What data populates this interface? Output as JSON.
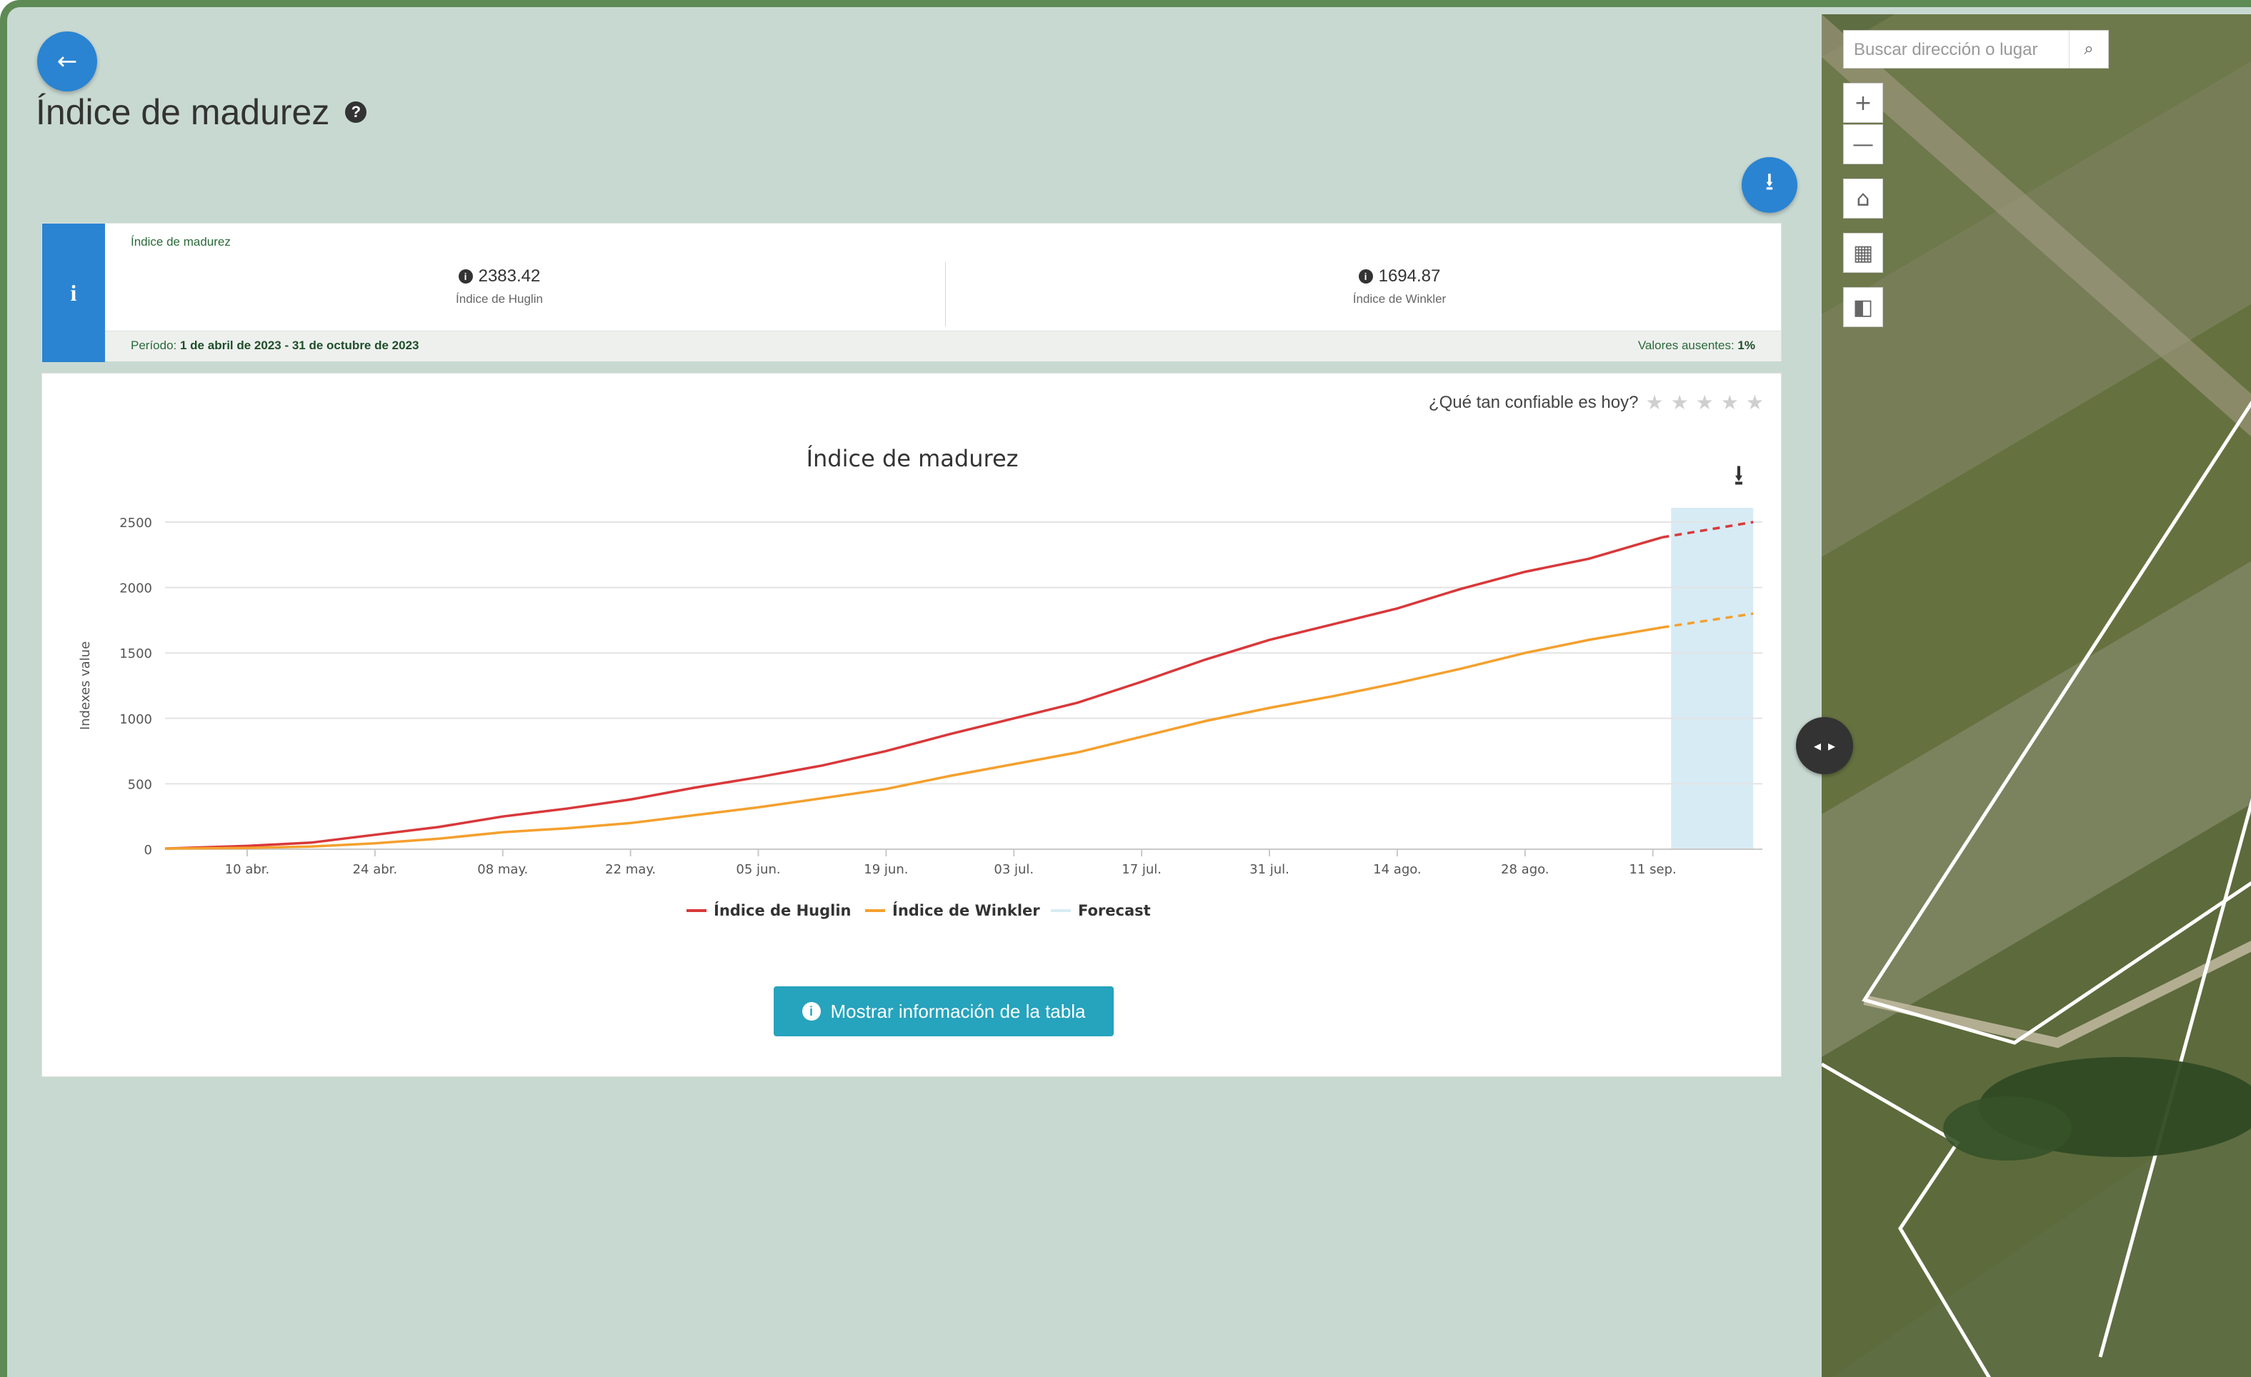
{
  "header": {
    "title": "Índice de madurez",
    "back_icon": "←",
    "download_icon": "⭳"
  },
  "info_card": {
    "title": "Índice de madurez",
    "badge": "i",
    "stats": [
      {
        "value": "2383.42",
        "label": "Índice de Huglin"
      },
      {
        "value": "1694.87",
        "label": "Índice de Winkler"
      }
    ],
    "period_label": "Período:",
    "period_value": "1 de abril de 2023 - 31 de octubre de 2023",
    "missing_label": "Valores ausentes:",
    "missing_value": "1%"
  },
  "rating": {
    "label": "¿Qué tan confiable es hoy?",
    "stars": 0,
    "max_stars": 5
  },
  "chart_data": {
    "type": "line",
    "title": "Índice de madurez",
    "ylabel": "Indexes value",
    "xlabel": "",
    "ylim": [
      0,
      2500
    ],
    "yticks": [
      0,
      500,
      1000,
      1500,
      2000,
      2500
    ],
    "xlim": [
      "2023-04-01",
      "2023-09-23"
    ],
    "xticks": [
      {
        "date": "2023-04-10",
        "label": "10 abr."
      },
      {
        "date": "2023-04-24",
        "label": "24 abr."
      },
      {
        "date": "2023-05-08",
        "label": "08 may."
      },
      {
        "date": "2023-05-22",
        "label": "22 may."
      },
      {
        "date": "2023-06-05",
        "label": "05 jun."
      },
      {
        "date": "2023-06-19",
        "label": "19 jun."
      },
      {
        "date": "2023-07-03",
        "label": "03 jul."
      },
      {
        "date": "2023-07-17",
        "label": "17 jul."
      },
      {
        "date": "2023-07-31",
        "label": "31 jul."
      },
      {
        "date": "2023-08-14",
        "label": "14 ago."
      },
      {
        "date": "2023-08-28",
        "label": "28 ago."
      },
      {
        "date": "2023-09-11",
        "label": "11 sep."
      }
    ],
    "forecast_range": [
      "2023-09-13",
      "2023-09-22"
    ],
    "series": [
      {
        "name": "Índice de Huglin",
        "color": "#d9383a",
        "points": [
          [
            "2023-04-01",
            5
          ],
          [
            "2023-04-10",
            25
          ],
          [
            "2023-04-17",
            50
          ],
          [
            "2023-04-24",
            110
          ],
          [
            "2023-05-01",
            170
          ],
          [
            "2023-05-08",
            250
          ],
          [
            "2023-05-15",
            310
          ],
          [
            "2023-05-22",
            380
          ],
          [
            "2023-05-29",
            470
          ],
          [
            "2023-06-05",
            550
          ],
          [
            "2023-06-12",
            640
          ],
          [
            "2023-06-19",
            750
          ],
          [
            "2023-06-26",
            880
          ],
          [
            "2023-07-03",
            1000
          ],
          [
            "2023-07-10",
            1120
          ],
          [
            "2023-07-17",
            1280
          ],
          [
            "2023-07-24",
            1450
          ],
          [
            "2023-07-31",
            1600
          ],
          [
            "2023-08-07",
            1720
          ],
          [
            "2023-08-14",
            1840
          ],
          [
            "2023-08-21",
            1990
          ],
          [
            "2023-08-28",
            2120
          ],
          [
            "2023-09-04",
            2220
          ],
          [
            "2023-09-12",
            2383
          ]
        ],
        "forecast": [
          [
            "2023-09-12",
            2383
          ],
          [
            "2023-09-22",
            2500
          ]
        ]
      },
      {
        "name": "Índice de Winkler",
        "color": "#f4a02e",
        "points": [
          [
            "2023-04-01",
            5
          ],
          [
            "2023-04-10",
            10
          ],
          [
            "2023-04-17",
            20
          ],
          [
            "2023-04-24",
            45
          ],
          [
            "2023-05-01",
            80
          ],
          [
            "2023-05-08",
            130
          ],
          [
            "2023-05-15",
            160
          ],
          [
            "2023-05-22",
            200
          ],
          [
            "2023-05-29",
            260
          ],
          [
            "2023-06-05",
            320
          ],
          [
            "2023-06-12",
            390
          ],
          [
            "2023-06-19",
            460
          ],
          [
            "2023-06-26",
            560
          ],
          [
            "2023-07-03",
            650
          ],
          [
            "2023-07-10",
            740
          ],
          [
            "2023-07-17",
            860
          ],
          [
            "2023-07-24",
            980
          ],
          [
            "2023-07-31",
            1080
          ],
          [
            "2023-08-07",
            1170
          ],
          [
            "2023-08-14",
            1270
          ],
          [
            "2023-08-21",
            1380
          ],
          [
            "2023-08-28",
            1500
          ],
          [
            "2023-09-04",
            1600
          ],
          [
            "2023-09-12",
            1695
          ]
        ],
        "forecast": [
          [
            "2023-09-12",
            1695
          ],
          [
            "2023-09-22",
            1800
          ]
        ]
      }
    ],
    "legend": [
      {
        "name": "Índice de Huglin",
        "color": "#d9383a"
      },
      {
        "name": "Índice de Winkler",
        "color": "#f4a02e"
      },
      {
        "name": "Forecast",
        "color": "#d7ebf5"
      }
    ],
    "grid": true,
    "legend_position": "bottom"
  },
  "chart_download_icon": "⭳",
  "table_button": {
    "icon": "i",
    "label": "Mostrar información de la tabla"
  },
  "map": {
    "search_placeholder": "Buscar dirección o lugar",
    "search_icon": "search-icon",
    "tools": [
      {
        "name": "zoom-in",
        "glyph": "+"
      },
      {
        "name": "zoom-out",
        "glyph": "—"
      },
      {
        "name": "home",
        "glyph": "⌂"
      },
      {
        "name": "basemap",
        "glyph": "▦"
      },
      {
        "name": "layers",
        "glyph": "◧"
      }
    ]
  },
  "splitter": {
    "left": "◂",
    "right": "▸"
  }
}
